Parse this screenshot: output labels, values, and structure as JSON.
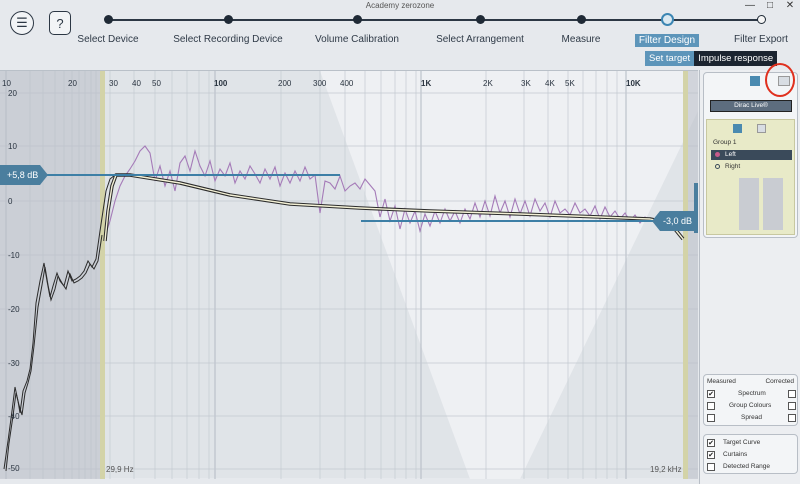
{
  "window": {
    "title": "Academy zerozone",
    "controls": [
      "—",
      "□",
      "✕"
    ]
  },
  "toolbar": {
    "menu_icon": "☰",
    "help_label": "?"
  },
  "steps": [
    {
      "label": "Select Device",
      "state": "done"
    },
    {
      "label": "Select Recording Device",
      "state": "done"
    },
    {
      "label": "Volume Calibration",
      "state": "done"
    },
    {
      "label": "Select Arrangement",
      "state": "done"
    },
    {
      "label": "Measure",
      "state": "done"
    },
    {
      "label": "Filter Design",
      "state": "active"
    },
    {
      "label": "Filter Export",
      "state": "open"
    }
  ],
  "sub_tabs": {
    "set_target": "Set target",
    "impulse_response": "Impulse response"
  },
  "plot": {
    "x_ticks": [
      "10",
      "20",
      "30",
      "40",
      "50",
      "100",
      "200",
      "300",
      "400",
      "1K",
      "2K",
      "3K",
      "4K",
      "5K",
      "10K"
    ],
    "y_ticks": [
      "20",
      "10",
      "0",
      "-10",
      "-20",
      "-30",
      "-40",
      "-50"
    ],
    "left_level_label": "+5,8 dB",
    "right_level_label": "-3,0 dB",
    "left_curtain_label": "29,9 Hz",
    "right_curtain_label": "19,2 kHz",
    "colors": {
      "target": "#3d7fa6",
      "measured": "#a57bb8",
      "curve": "#2b2b2b",
      "curtain": "#c9c99b"
    }
  },
  "panel": {
    "source_select": "Dirac Live®",
    "group": {
      "label": "Group 1",
      "channels": [
        {
          "label": "Left",
          "selected": true
        },
        {
          "label": "Right",
          "selected": false
        }
      ]
    },
    "display_options": {
      "measured_header": "Measured",
      "corrected_header": "Corrected",
      "rows": [
        {
          "label": "Spectrum",
          "measured": "✔",
          "corrected": ""
        },
        {
          "label": "Group Colours",
          "measured": "",
          "corrected": ""
        },
        {
          "label": "Spread",
          "measured": "",
          "corrected": ""
        }
      ]
    },
    "curve_options": [
      {
        "label": "Target Curve",
        "checked": "✔"
      },
      {
        "label": "Curtains",
        "checked": "✔"
      },
      {
        "label": "Detected Range",
        "checked": ""
      }
    ]
  }
}
